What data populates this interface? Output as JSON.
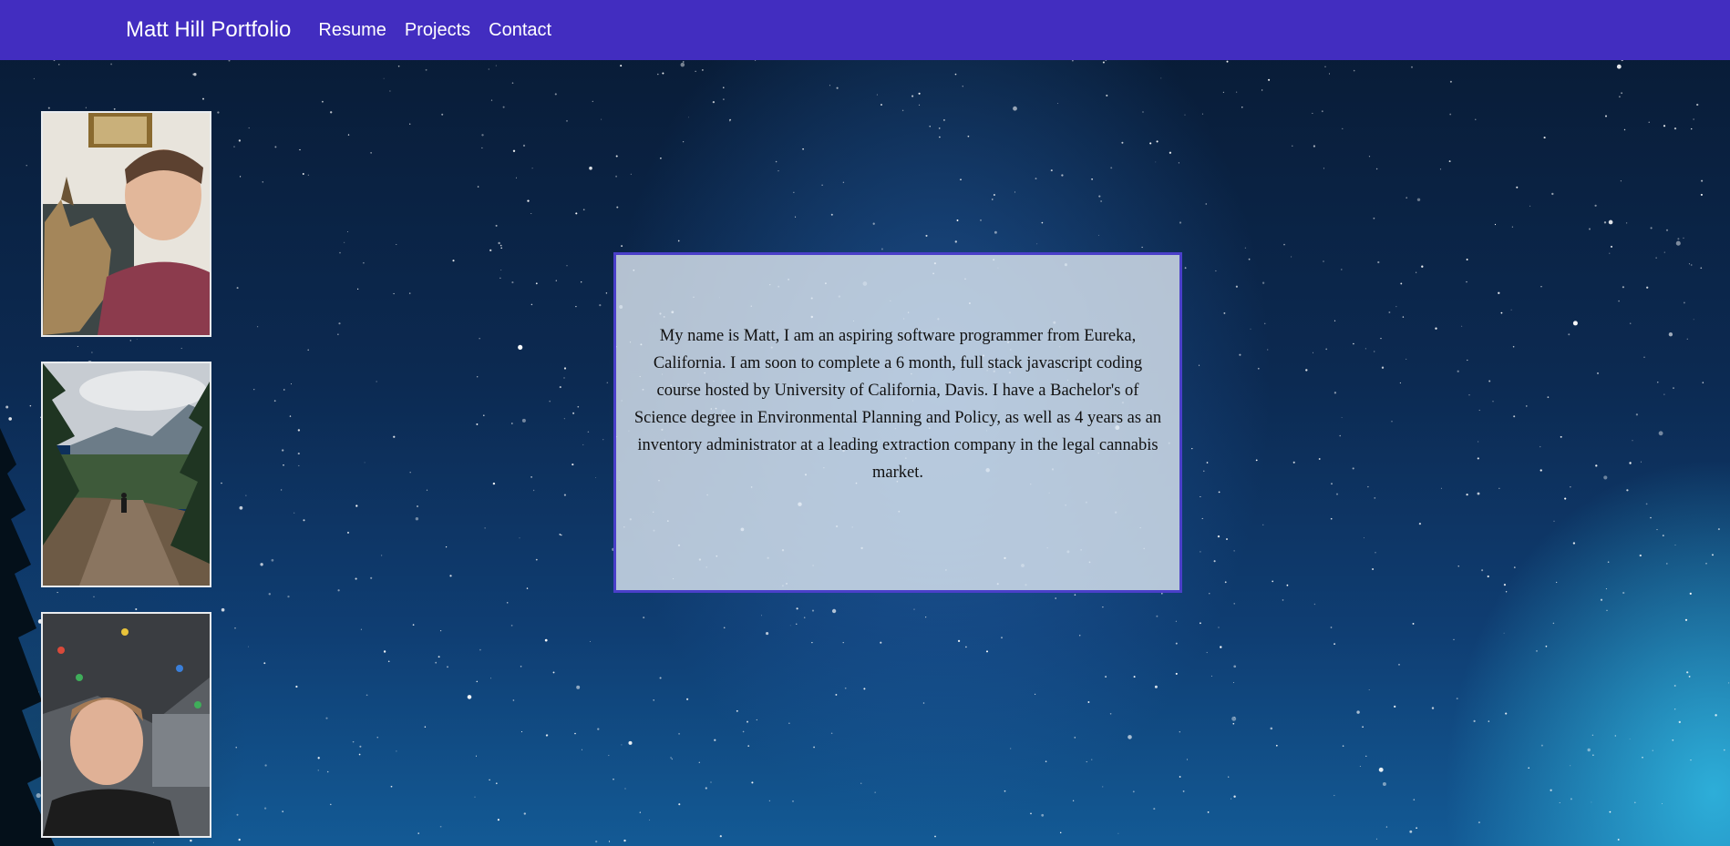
{
  "navbar": {
    "brand": "Matt Hill Portfolio",
    "links": [
      "Resume",
      "Projects",
      "Contact"
    ],
    "background_color": "#422dc0"
  },
  "sidebar": {
    "photos": [
      {
        "description": "selfie with dog on couch"
      },
      {
        "description": "hiker on forest trail with mountains"
      },
      {
        "description": "selfie at climbing gym"
      }
    ]
  },
  "about": {
    "text": "My name is Matt, I am an aspiring software programmer from Eureka, California. I am soon to complete a 6 month, full stack javascript coding course hosted by University of California, Davis. I have a Bachelor's of Science degree in Environmental Planning and Policy, as well as 4 years as an inventory administrator at a leading extraction company in the legal cannabis market.",
    "border_color": "#4a3fc9"
  },
  "background": {
    "description": "starry night sky"
  }
}
